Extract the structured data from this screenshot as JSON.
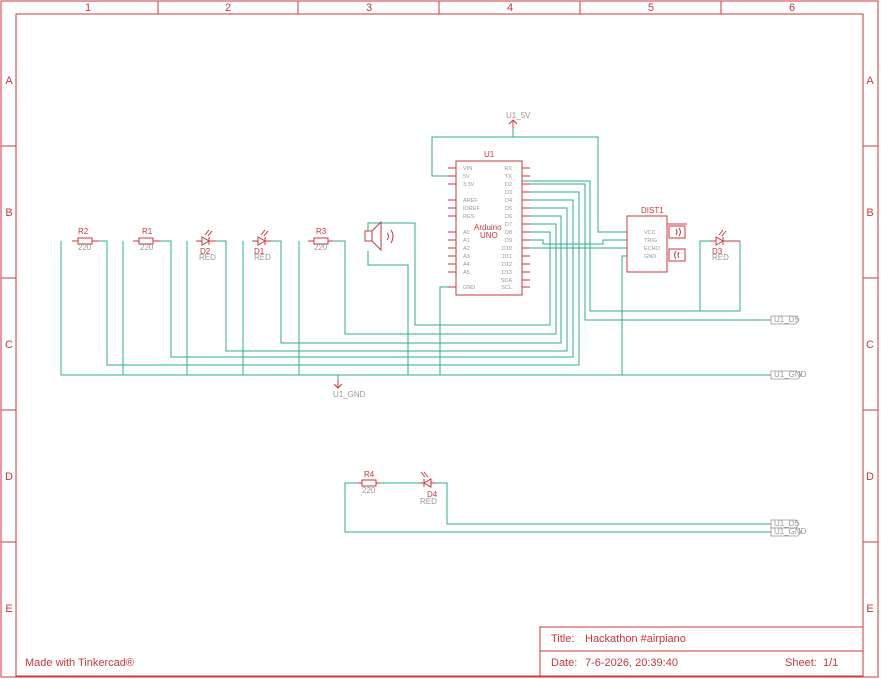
{
  "frame": {
    "columns": [
      "1",
      "2",
      "3",
      "4",
      "5",
      "6"
    ],
    "rows": [
      "A",
      "B",
      "C",
      "D",
      "E"
    ]
  },
  "footer": {
    "made_with": "Made with Tinkercad®"
  },
  "title_block": {
    "title_label": "Title:",
    "title": "Hackathon #airpiano",
    "date_label": "Date:",
    "date": "7-6-2026, 20:39:40",
    "sheet_label": "Sheet:",
    "sheet": "1/1"
  },
  "parts": {
    "u1": {
      "ref": "U1",
      "name1": "Arduino",
      "name2": "UNO",
      "left_pins": [
        "VIN",
        "5V",
        "3.3V",
        "AREF",
        "IOREF",
        "RES",
        "A0",
        "A1",
        "A2",
        "A3",
        "A4",
        "A5",
        "GND"
      ],
      "right_pins": [
        "RX",
        "TX",
        "D2",
        "D3",
        "D4",
        "D5",
        "D6",
        "D7",
        "D8",
        "D9",
        "D10",
        "D11",
        "D12",
        "D13",
        "SDA",
        "SCL"
      ]
    },
    "dist1": {
      "ref": "DIST1",
      "pins": [
        "VCC",
        "TRIG",
        "ECHO",
        "GND"
      ]
    },
    "r1": {
      "ref": "R1",
      "value": "220"
    },
    "r2": {
      "ref": "R2",
      "value": "220"
    },
    "r3": {
      "ref": "R3",
      "value": "220"
    },
    "r4": {
      "ref": "R4",
      "value": "220"
    },
    "d1": {
      "ref": "D1",
      "value": "RED"
    },
    "d2": {
      "ref": "D2",
      "value": "RED"
    },
    "d3": {
      "ref": "D3",
      "value": "RED"
    },
    "d4": {
      "ref": "D4",
      "value": "RED"
    }
  },
  "nets": {
    "u1_5v": "U1_5V",
    "u1_gnd": "U1_GND",
    "u1_d5": "U1_D5"
  }
}
